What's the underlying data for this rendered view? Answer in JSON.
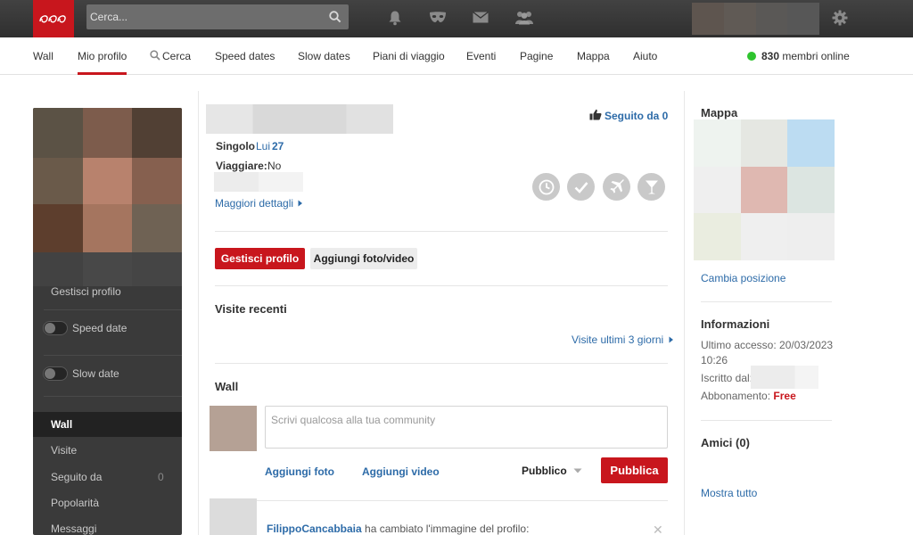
{
  "search": {
    "placeholder": "Cerca..."
  },
  "nav": {
    "items": [
      "Wall",
      "Mio profilo",
      "Cerca",
      "Speed dates",
      "Slow dates",
      "Piani di viaggio",
      "Eventi",
      "Pagine",
      "Mappa",
      "Aiuto"
    ],
    "active": "Mio profilo",
    "online_count": "830",
    "online_label": "membri online"
  },
  "sidebar": {
    "manage_profile": "Gestisci profilo",
    "speed_date": "Speed date",
    "slow_date": "Slow date",
    "menu": [
      {
        "label": "Wall",
        "active": true
      },
      {
        "label": "Visite"
      },
      {
        "label": "Seguito da",
        "count": "0"
      },
      {
        "label": "Popolarità"
      },
      {
        "label": "Messaggi"
      }
    ]
  },
  "profile": {
    "followed_label": "Seguito da 0",
    "status_label": "Singolo",
    "gender_label": "Lui",
    "age": "27",
    "travel_label": "Viaggiare:",
    "travel_value": "No",
    "more_details": "Maggiori dettagli",
    "manage_button": "Gestisci profilo",
    "add_media_button": "Aggiungi foto/video"
  },
  "visits": {
    "title": "Visite recenti",
    "link": "Visite ultimi 3 giorni"
  },
  "wall": {
    "title": "Wall",
    "placeholder": "Scrivi qualcosa alla tua community",
    "add_photo": "Aggiungi foto",
    "add_video": "Aggiungi video",
    "visibility": "Pubblico",
    "publish": "Pubblica",
    "post_user": "FilippoCancabbaia",
    "post_text": "ha cambiato l'immagine del profilo:"
  },
  "map": {
    "title": "Mappa",
    "change_position": "Cambia posizione"
  },
  "info": {
    "title": "Informazioni",
    "last_access_label": "Ultimo accesso:",
    "last_access_date": "20/03/2023",
    "last_access_time": "10:26",
    "registered_label": "Iscritto dal:",
    "subscription_label": "Abbonamento:",
    "subscription_value": "Free"
  },
  "friends": {
    "title": "Amici (0)",
    "show_all": "Mostra tutto"
  },
  "colors": {
    "brand": "#c8161d",
    "link": "#2d6ba8",
    "online": "#2ec42e"
  },
  "icons": [
    "logo",
    "search-icon",
    "bell-icon",
    "mask-icon",
    "mail-icon",
    "people-icon",
    "gear-icon",
    "thumb-up-icon",
    "clock-icon",
    "check-icon",
    "plane-icon",
    "cocktail-icon",
    "chevron-right-icon",
    "caret-down-icon",
    "close-icon"
  ]
}
